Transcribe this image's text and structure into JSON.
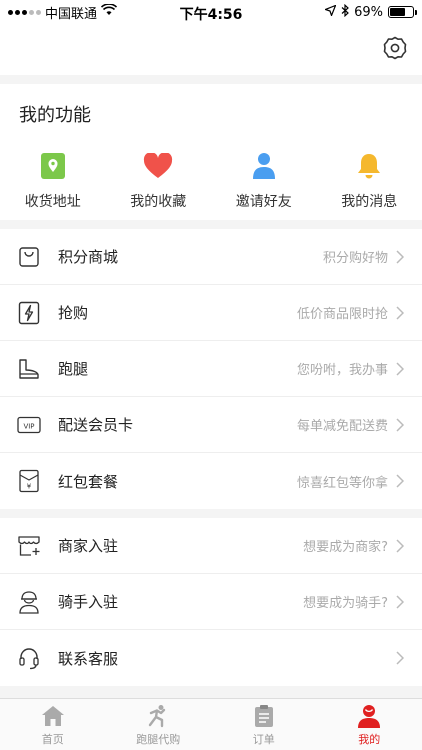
{
  "status_bar": {
    "carrier": "中国联通",
    "time": "下午4:56",
    "battery": "69%",
    "battery_level": 0.69
  },
  "settings": {
    "icon": "gear-icon"
  },
  "features": {
    "title": "我的功能",
    "items": [
      {
        "label": "收货地址",
        "icon": "location-pin-icon",
        "color": "#7cc84a"
      },
      {
        "label": "我的收藏",
        "icon": "heart-icon",
        "color": "#f0524a"
      },
      {
        "label": "邀请好友",
        "icon": "user-icon",
        "color": "#4a9ef0"
      },
      {
        "label": "我的消息",
        "icon": "bell-icon",
        "color": "#f5b82e"
      }
    ]
  },
  "menu_group_1": [
    {
      "label": "积分商城",
      "hint": "积分购好物",
      "icon": "shopping-bag-icon"
    },
    {
      "label": "抢购",
      "hint": "低价商品限时抢",
      "icon": "flash-icon"
    },
    {
      "label": "跑腿",
      "hint": "您吩咐，我办事",
      "icon": "boot-icon"
    },
    {
      "label": "配送会员卡",
      "hint": "每单减免配送费",
      "icon": "vip-card-icon"
    },
    {
      "label": "红包套餐",
      "hint": "惊喜红包等你拿",
      "icon": "red-packet-icon"
    }
  ],
  "menu_group_2": [
    {
      "label": "商家入驻",
      "hint": "想要成为商家?",
      "icon": "store-add-icon"
    },
    {
      "label": "骑手入驻",
      "hint": "想要成为骑手?",
      "icon": "rider-icon"
    },
    {
      "label": "联系客服",
      "hint": "",
      "icon": "headset-icon"
    }
  ],
  "tabs": [
    {
      "label": "首页",
      "icon": "home-icon",
      "active": false
    },
    {
      "label": "跑腿代购",
      "icon": "runner-icon",
      "active": false
    },
    {
      "label": "订单",
      "icon": "clipboard-icon",
      "active": false
    },
    {
      "label": "我的",
      "icon": "profile-icon",
      "active": true
    }
  ],
  "colors": {
    "accent": "#e02020",
    "hint": "#aaaaaa",
    "tab_inactive": "#999999"
  }
}
